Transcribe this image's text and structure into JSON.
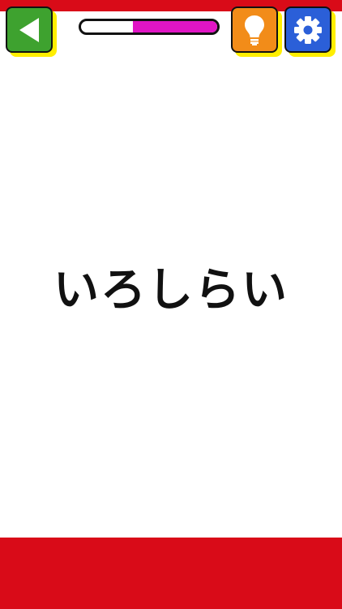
{
  "game": {
    "word": "いろしらい",
    "progress": 0.62
  },
  "buttons": {
    "back": {
      "icon": "play-back-icon",
      "color": "#3ea22f"
    },
    "hint": {
      "icon": "lightbulb-icon",
      "color": "#f28c19"
    },
    "settings": {
      "icon": "gear-icon",
      "color": "#2b5fd8"
    }
  },
  "colors": {
    "frame_red": "#d90b18",
    "button_shadow": "#ffee00",
    "progress_fill": "#e015c4"
  }
}
